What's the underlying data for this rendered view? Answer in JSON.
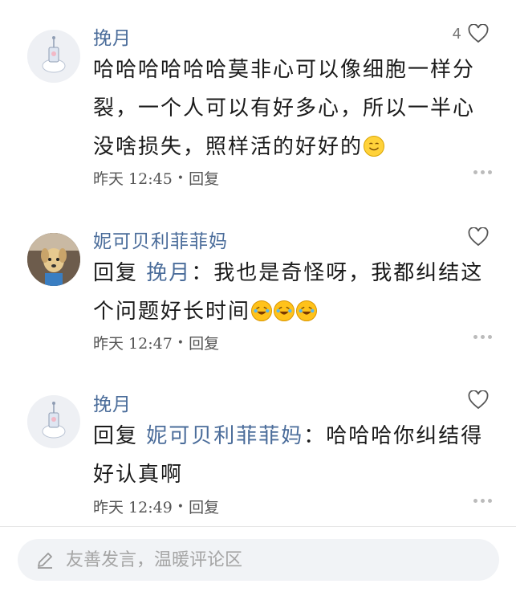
{
  "comments": [
    {
      "username": "挽月",
      "like_count": "4",
      "text": "哈哈哈哈哈哈莫非心可以像细胞一样分裂，一个人可以有好多心，所以一半心没啥损失，照样活的好好的",
      "emojis": [
        "smile-emoji"
      ],
      "time": "昨天 12:45",
      "reply_label": "回复"
    },
    {
      "username": "妮可贝利菲菲妈",
      "like_count": "",
      "reply_prefix": "回复",
      "mention": "挽月",
      "text": "：我也是奇怪呀，我都纠结这个问题好长时间",
      "emojis": [
        "laugh-cry-emoji",
        "laugh-cry-emoji",
        "laugh-cry-emoji"
      ],
      "time": "昨天 12:47",
      "reply_label": "回复"
    },
    {
      "username": "挽月",
      "like_count": "",
      "reply_prefix": "回复",
      "mention": "妮可贝利菲菲妈",
      "text": "：哈哈哈你纠结得好认真啊",
      "time": "昨天 12:49",
      "reply_label": "回复"
    }
  ],
  "input": {
    "placeholder": "友善发言，温暖评论区"
  },
  "colors": {
    "username": "#4a6c9a",
    "text": "#1a1a1a",
    "meta": "#555555",
    "input_bg": "#f1f3f6"
  }
}
